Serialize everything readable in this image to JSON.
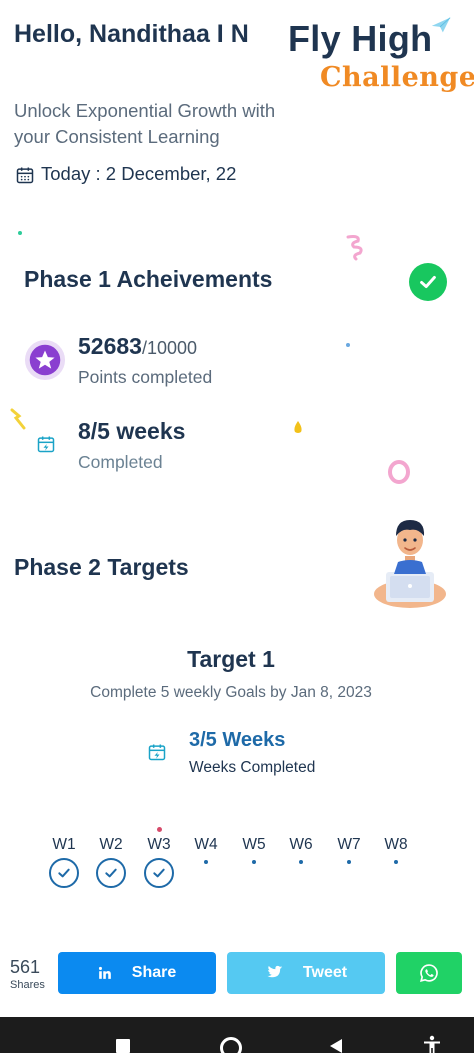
{
  "header": {
    "greeting": "Hello, Nandithaa I N",
    "logo_line1": "Fly High",
    "logo_line2": "Challenge",
    "tagline": "Unlock Exponential Growth with your Consistent Learning",
    "today": "Today : 2 December, 22"
  },
  "phase1": {
    "title": "Phase 1 Acheivements",
    "points_value": "52683",
    "points_total": "/10000",
    "points_label": "Points completed",
    "weeks_value": "8/5 weeks",
    "weeks_label": "Completed"
  },
  "phase2": {
    "title": "Phase 2 Targets",
    "target_title": "Target 1",
    "target_desc": "Complete 5 weekly Goals by Jan 8, 2023",
    "target_value": "3/5 Weeks",
    "target_label": "Weeks Completed",
    "weeks": [
      {
        "label": "W1",
        "done": true
      },
      {
        "label": "W2",
        "done": true
      },
      {
        "label": "W3",
        "done": true
      },
      {
        "label": "W4",
        "done": false
      },
      {
        "label": "W5",
        "done": false
      },
      {
        "label": "W6",
        "done": false
      },
      {
        "label": "W7",
        "done": false
      },
      {
        "label": "W8",
        "done": false
      }
    ]
  },
  "share": {
    "count": "561",
    "count_label": "Shares",
    "linkedin_label": "Share",
    "twitter_label": "Tweet",
    "whatsapp_icon": "whatsapp-icon"
  },
  "colors": {
    "primary_text": "#1f3550",
    "accent_blue": "#1e6aa8",
    "success_green": "#18c75f",
    "brand_orange": "#f08a24",
    "linkedin": "#0b8af0",
    "twitter": "#55c9f2",
    "whatsapp": "#20d266"
  }
}
